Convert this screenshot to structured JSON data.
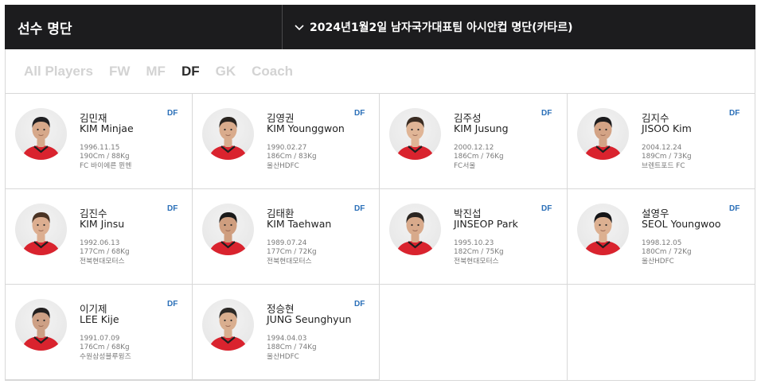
{
  "header": {
    "title": "선수 명단",
    "selected_roster": "2024년1월2일 남자국가대표팀 아시안컵 명단(카타르)"
  },
  "tabs": [
    {
      "label": "All Players",
      "active": false
    },
    {
      "label": "FW",
      "active": false
    },
    {
      "label": "MF",
      "active": false
    },
    {
      "label": "DF",
      "active": true
    },
    {
      "label": "GK",
      "active": false
    },
    {
      "label": "Coach",
      "active": false
    }
  ],
  "colors": {
    "header_bg": "#1c1c1e",
    "position_badge": "#2a6fb8",
    "jersey_red": "#d9232e"
  },
  "players": [
    {
      "name_ko": "김민재",
      "name_en": "KIM Minjae",
      "position": "DF",
      "birth": "1996.11.15",
      "body": "190Cm / 88Kg",
      "club": "FC 바이에른 뮌헨"
    },
    {
      "name_ko": "김영권",
      "name_en": "KIM Younggwon",
      "position": "DF",
      "birth": "1990.02.27",
      "body": "186Cm / 83Kg",
      "club": "울산HDFC"
    },
    {
      "name_ko": "김주성",
      "name_en": "KIM Jusung",
      "position": "DF",
      "birth": "2000.12.12",
      "body": "186Cm / 76Kg",
      "club": "FC서울"
    },
    {
      "name_ko": "김지수",
      "name_en": "JISOO Kim",
      "position": "DF",
      "birth": "2004.12.24",
      "body": "189Cm / 73Kg",
      "club": "브렌트포드 FC"
    },
    {
      "name_ko": "김진수",
      "name_en": "KIM Jinsu",
      "position": "DF",
      "birth": "1992.06.13",
      "body": "177Cm / 68Kg",
      "club": "전북현대모터스"
    },
    {
      "name_ko": "김태환",
      "name_en": "KIM Taehwan",
      "position": "DF",
      "birth": "1989.07.24",
      "body": "177Cm / 72Kg",
      "club": "전북현대모터스"
    },
    {
      "name_ko": "박진섭",
      "name_en": "JINSEOP Park",
      "position": "DF",
      "birth": "1995.10.23",
      "body": "182Cm / 75Kg",
      "club": "전북현대모터스"
    },
    {
      "name_ko": "설영우",
      "name_en": "SEOL Youngwoo",
      "position": "DF",
      "birth": "1998.12.05",
      "body": "180Cm / 72Kg",
      "club": "울산HDFC"
    },
    {
      "name_ko": "이기제",
      "name_en": "LEE Kije",
      "position": "DF",
      "birth": "1991.07.09",
      "body": "176Cm / 68Kg",
      "club": "수원삼성블루윙즈"
    },
    {
      "name_ko": "정승현",
      "name_en": "JUNG Seunghyun",
      "position": "DF",
      "birth": "1994.04.03",
      "body": "188Cm / 74Kg",
      "club": "울산HDFC"
    }
  ]
}
